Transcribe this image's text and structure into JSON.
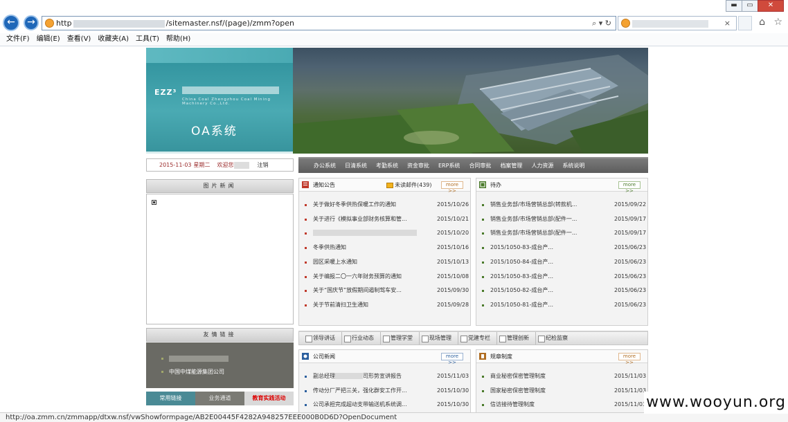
{
  "browser": {
    "address_prefix": "http",
    "address_suffix": "/sitemaster.nsf/(page)/zmm?open",
    "address_tools": "⌕ ▾ ↻",
    "tab_close": "×",
    "window_buttons": [
      "▬",
      "▭",
      "✕"
    ],
    "home_icons": "⌂ ☆",
    "back": "←",
    "forward": "→",
    "menu": [
      "文件(F)",
      "编辑(E)",
      "查看(V)",
      "收藏夹(A)",
      "工具(T)",
      "帮助(H)"
    ],
    "status_url": "http://oa.zmm.cn/zmmapp/dtxw.nsf/vwShowformpage/AB2E00445F4282A948257EEE000B0D6D?OpenDocument"
  },
  "banner": {
    "logo_text": "EZZ³",
    "logo_sub": "China Coal Zhengzhou Coal Mining Machinery Co.,Ltd.",
    "system_title": "OA系统"
  },
  "datebar": {
    "date": "2015-11-03",
    "weekday": "星期二",
    "greeting": "欢迎您",
    "logout": "注销"
  },
  "main_nav": [
    "办公系统",
    "日清系统",
    "考勤系统",
    "资金审批",
    "ERP系统",
    "合同审批",
    "档案管理",
    "人力资源",
    "系统说明"
  ],
  "left": {
    "pic_news_title": "图片新闻",
    "friend_links_title": "友情链接",
    "friend_link_2": "中国中煤能源集团公司",
    "tabs": [
      "常用链接",
      "业务通道",
      "教育实践活动"
    ]
  },
  "notice": {
    "title": "通知公告",
    "unread": "未读邮件(439)",
    "more": "more >>",
    "items": [
      {
        "title": "关于做好冬季供热保暖工作的通知",
        "date": "2015/10/26"
      },
      {
        "title": "关于进行《模拟事业部财务核算和管...",
        "date": "2015/10/21"
      },
      {
        "title": "",
        "date": "2015/10/20"
      },
      {
        "title": "冬季供热通知",
        "date": "2015/10/16"
      },
      {
        "title": "园区采暖上水通知",
        "date": "2015/10/13"
      },
      {
        "title": "关于编报二〇一六年财务预算的通知",
        "date": "2015/10/08"
      },
      {
        "title": "关于“国庆节”放假期间遏制驾车安...",
        "date": "2015/09/30"
      },
      {
        "title": "关于节前清扫卫生通知",
        "date": "2015/09/28"
      }
    ]
  },
  "todo": {
    "title": "待办",
    "more": "more >>",
    "items": [
      {
        "title": "销售业务部/市场营销总部(转款机...",
        "date": "2015/09/22"
      },
      {
        "title": "销售业务部/市场营销总部(配件一...",
        "date": "2015/09/17"
      },
      {
        "title": "销售业务部/市场营销总部(配件一...",
        "date": "2015/09/17"
      },
      {
        "title": "2015/1050-83-成台产...",
        "date": "2015/06/23"
      },
      {
        "title": "2015/1050-84-成台产...",
        "date": "2015/06/23"
      },
      {
        "title": "2015/1050-83-成台产...",
        "date": "2015/06/23"
      },
      {
        "title": "2015/1050-82-成台产...",
        "date": "2015/06/23"
      },
      {
        "title": "2015/1050-81-成台产...",
        "date": "2015/06/23"
      }
    ]
  },
  "toolbar2": [
    "领导讲话",
    "行业动态",
    "管理学堂",
    "现场管理",
    "党建专栏",
    "管理创新",
    "纪检监察"
  ],
  "company_news": {
    "title": "公司新闻",
    "more": "more >>",
    "items": [
      {
        "title": "副总经理",
        "title_suffix": "司形势宣讲报告",
        "date": "2015/11/03"
      },
      {
        "title": "传动分厂严把三关，强化群安工作开...",
        "date": "2015/10/30"
      },
      {
        "title": "公司承担完成超动支带输送机系统调...",
        "date": "2015/10/30"
      }
    ]
  },
  "rules": {
    "title": "规章制度",
    "more": "more >>",
    "items": [
      {
        "title": "商业秘密保密管理制度",
        "date": "2015/11/03"
      },
      {
        "title": "国家秘密保密管理制度",
        "date": "2015/11/03"
      },
      {
        "title": "信访接待管理制度",
        "date": "2015/11/03"
      }
    ]
  },
  "watermark": "www.wooyun.org",
  "colors": {
    "accent_teal": "#4aaab3",
    "nav_gray": "#6b6b6b",
    "red_bullet": "#c0392b",
    "blue_bullet": "#2b5f9e",
    "green_bullet": "#4a7a2a"
  }
}
